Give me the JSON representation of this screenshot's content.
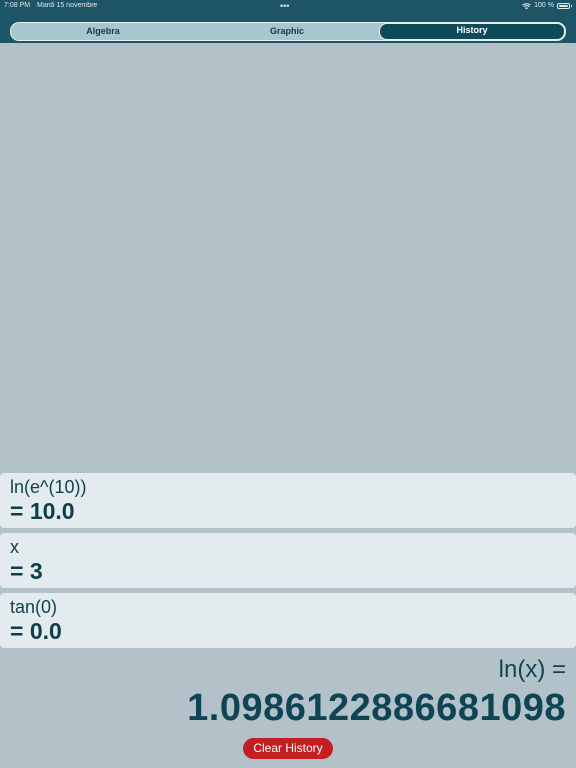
{
  "status_bar": {
    "time": "7:08 PM",
    "date": "Mardi 15 novembre",
    "dots": "•••",
    "battery_text": "100 %"
  },
  "tabs": [
    {
      "label": "Algebra",
      "active": false
    },
    {
      "label": "Graphic",
      "active": false
    },
    {
      "label": "History",
      "active": true
    }
  ],
  "history": [
    {
      "expression": "ln(e^(10))",
      "result": "= 10.0"
    },
    {
      "expression": "x",
      "result": "= 3"
    },
    {
      "expression": "tan(0)",
      "result": "= 0.0"
    }
  ],
  "current": {
    "expression": "ln(x) =",
    "result": "1.0986122886681098"
  },
  "clear_button_label": "Clear History",
  "colors": {
    "background": "#b3c2c8",
    "header": "#1e5566",
    "accent": "#0e4a5a",
    "danger": "#c21f22"
  }
}
